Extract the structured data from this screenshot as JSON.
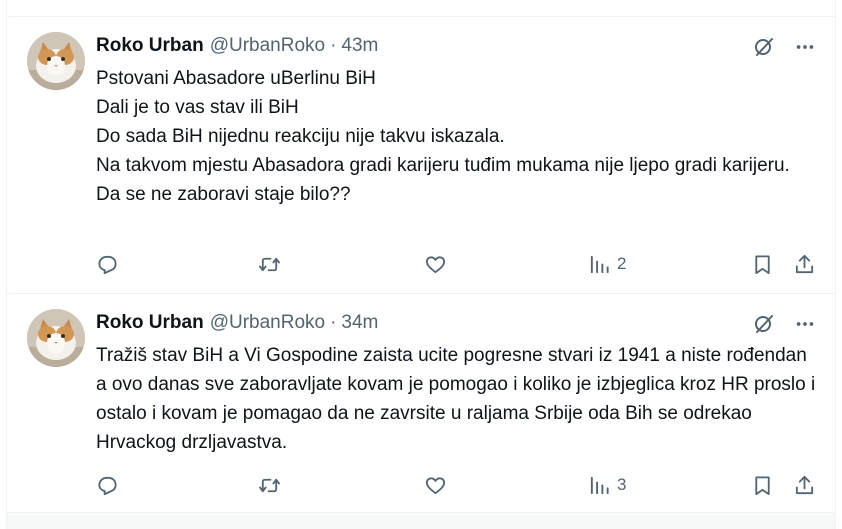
{
  "tweets": [
    {
      "author_name": "Roko Urban",
      "handle": "@UrbanRoko",
      "separator": "·",
      "time": "43m",
      "lines": [
        "Pstovani Abasadore uBerlinu BiH",
        "Dali je to vas stav ili BiH",
        "Do sada BiH nijednu reakciju nije takvu iskazala.",
        "Na takvom mjestu Abasadora  gradi karijeru tuđim mukama nije ljepo gradi karijeru.",
        "Da se ne zaboravi staje bilo??"
      ],
      "views": "2"
    },
    {
      "author_name": "Roko Urban",
      "handle": "@UrbanRoko",
      "separator": "·",
      "time": "34m",
      "lines": [
        "Tražiš stav BiH a Vi Gospodine zaista ucite pogresne stvari iz 1941 a niste rođendan a ovo danas sve zaboravljate kovam je pomogao i koliko je izbjeglica kroz HR proslo i ostalo i kovam je pomagao da ne zavrsite u raljama Srbije  oda Bih se odrekao Hrvackog drzljavastva."
      ],
      "views": "3"
    }
  ],
  "icons": {
    "reply": "reply-icon",
    "retweet": "retweet-icon",
    "like": "like-icon",
    "views": "views-icon",
    "bookmark": "bookmark-icon",
    "share": "share-icon",
    "grok": "grok-icon",
    "more": "more-icon"
  },
  "colors": {
    "text": "#0f1419",
    "secondary": "#536471",
    "border": "#eff3f4"
  }
}
